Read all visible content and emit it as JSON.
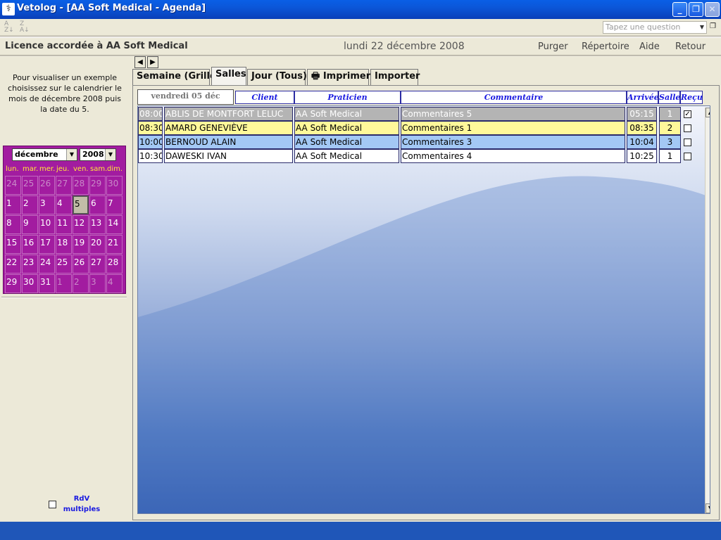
{
  "window": {
    "title": "Vetolog - [AA Soft Medical - Agenda]",
    "icon": "caduceus-icon",
    "controls": [
      "minimize",
      "restore",
      "close"
    ]
  },
  "toolbar": {
    "sort_asc_icon": "sort-az-icon",
    "sort_desc_icon": "sort-za-icon",
    "help_placeholder": "Tapez une question"
  },
  "header": {
    "license": "Licence accordée à  AA Soft Medical",
    "date": "lundi 22 décembre 2008",
    "links": [
      "Purger",
      "Répertoire",
      "Aide",
      "Retour"
    ]
  },
  "left": {
    "hint": "Pour visualiser un exemple choisissez sur le calendrier le mois de décembre  2008 puis la date du 5.",
    "calendar": {
      "month": "décembre",
      "year": "2008",
      "days_header": [
        "lun.",
        "mar.",
        "mer.",
        "jeu.",
        "ven.",
        "sam.",
        "dim."
      ],
      "weeks": [
        [
          "24",
          "25",
          "26",
          "27",
          "28",
          "29",
          "30"
        ],
        [
          "1",
          "2",
          "3",
          "4",
          "5",
          "6",
          "7"
        ],
        [
          "8",
          "9",
          "10",
          "11",
          "12",
          "13",
          "14"
        ],
        [
          "15",
          "16",
          "17",
          "18",
          "19",
          "20",
          "21"
        ],
        [
          "22",
          "23",
          "24",
          "25",
          "26",
          "27",
          "28"
        ],
        [
          "29",
          "30",
          "31",
          "1",
          "2",
          "3",
          "4"
        ]
      ],
      "selected": "5"
    },
    "rdv_label_1": "RdV",
    "rdv_label_2": "multiples"
  },
  "tabs": {
    "semaine": "Semaine (Grille)",
    "salles": "Salles",
    "jour": "Jour (Tous)",
    "imprimer": "Imprimer",
    "importer": "Importer",
    "active": "Salles"
  },
  "grid": {
    "date_header": "vendredi 05 déc",
    "columns": {
      "client": "Client",
      "praticien": "Praticien",
      "commentaire": "Commentaire",
      "arrivee": "Arrivée",
      "salle": "Salle",
      "recu": "Reçu"
    },
    "rows": [
      {
        "time": "08:00",
        "client": "ABLIS DE MONTFORT LELUC",
        "praticien": "AA Soft Medical",
        "commentaire": "Commentaires 5",
        "arrivee": "05:15",
        "salle": "1",
        "recu": true,
        "color": "#b4b4b4",
        "text": "#ffffff"
      },
      {
        "time": "08:30",
        "client": "AMARD GENEVIÈVE",
        "praticien": "AA Soft Medical",
        "commentaire": "Commentaires 1",
        "arrivee": "08:35",
        "salle": "2",
        "recu": false,
        "color": "#fff89a",
        "text": "#000000"
      },
      {
        "time": "10:00",
        "client": "BERNOUD ALAIN",
        "praticien": "AA Soft Medical",
        "commentaire": "Commentaires 3",
        "arrivee": "10:04",
        "salle": "3",
        "recu": false,
        "color": "#a3c8f5",
        "text": "#000000"
      },
      {
        "time": "10:30",
        "client": "DAWESKI IVAN",
        "praticien": "AA Soft Medical",
        "commentaire": "Commentaires 4",
        "arrivee": "10:25",
        "salle": "1",
        "recu": false,
        "color": "#ffffff",
        "text": "#000000"
      }
    ]
  },
  "colors": {
    "calendar_bg": "#a21ca0",
    "header_link": "#1a1ae0"
  }
}
